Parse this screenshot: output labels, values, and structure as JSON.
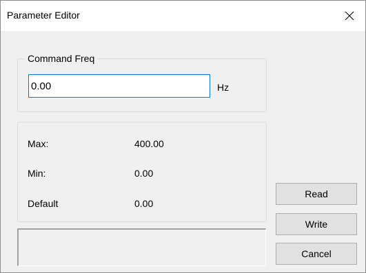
{
  "window": {
    "title": "Parameter Editor",
    "close_glyph": "✕"
  },
  "command_group": {
    "legend": "Command Freq",
    "input_value": "0.00",
    "unit": "Hz"
  },
  "limits": {
    "max_label": "Max:",
    "max_value": "400.00",
    "min_label": "Min:",
    "min_value": "0.00",
    "default_label": "Default",
    "default_value": "0.00"
  },
  "status_text": "",
  "buttons": {
    "read": "Read",
    "write": "Write",
    "cancel": "Cancel"
  },
  "colors": {
    "input_focus_border": "#0078d7",
    "dialog_background": "#f0f0f0"
  },
  "icons": {
    "close": "close-icon"
  }
}
